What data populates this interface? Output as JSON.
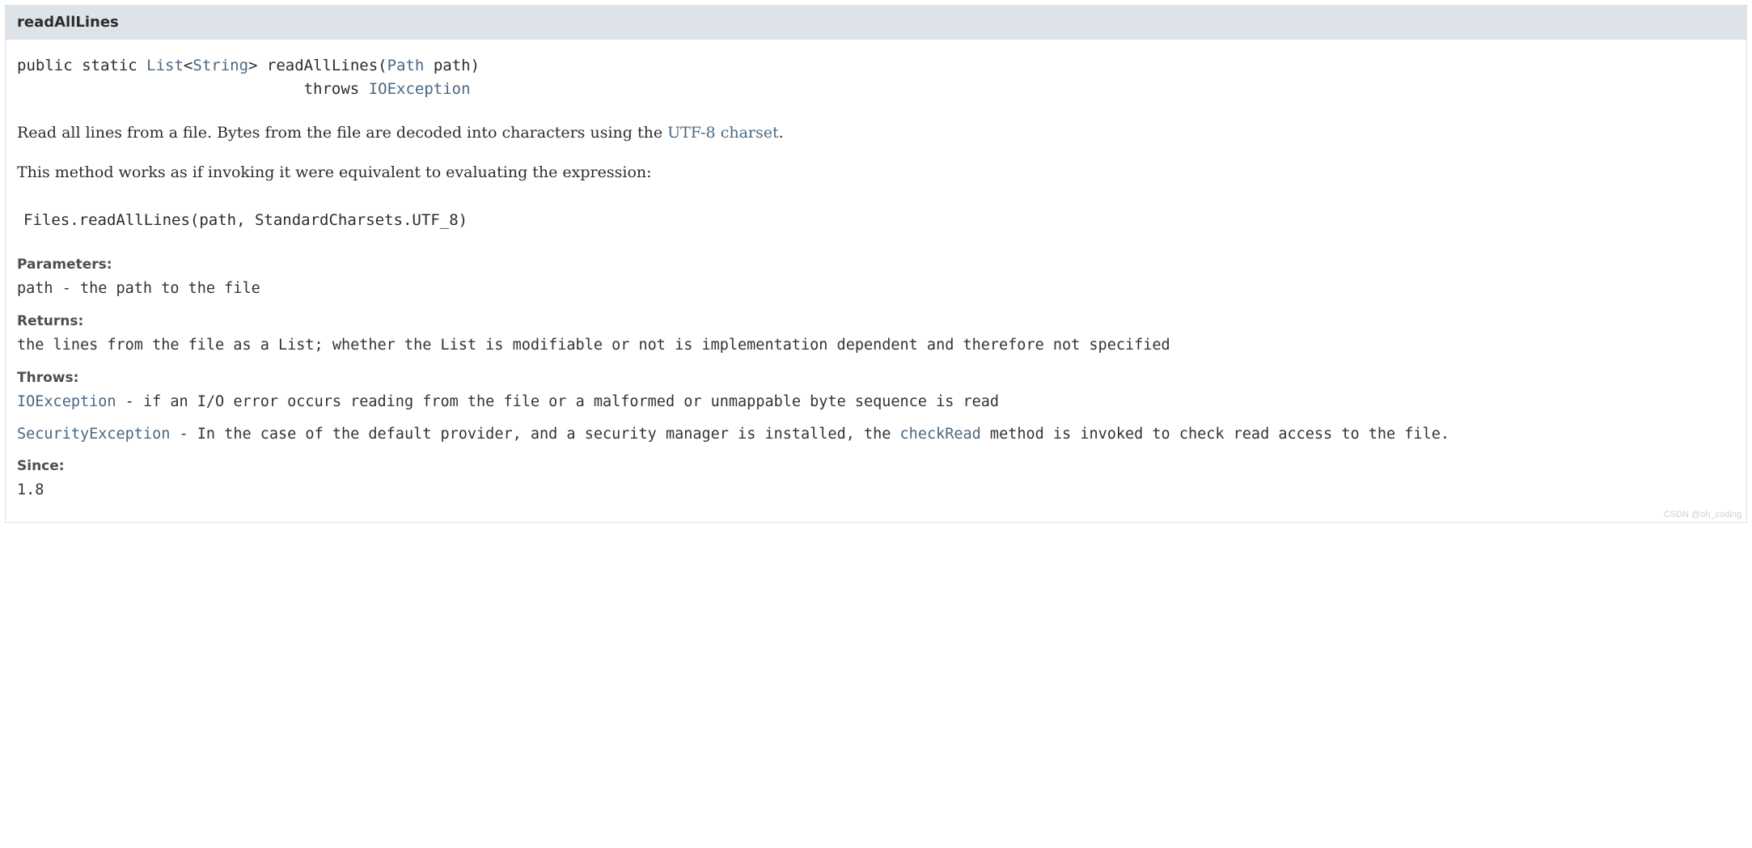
{
  "header": {
    "method_name": "readAllLines"
  },
  "signature": {
    "line1_prefix": "public static ",
    "list_link": "List",
    "angle_open": "<",
    "string_link": "String",
    "angle_close": "> readAllLines(",
    "path_link": "Path",
    "line1_suffix": " path)",
    "line2_indent": "                               throws ",
    "ioexception_link": "IOException"
  },
  "desc": {
    "para1_a": "Read all lines from a file. Bytes from the file are decoded into characters using the ",
    "utf8_link": "UTF-8 charset",
    "para1_b": ".",
    "para2": "This method works as if invoking it were equivalent to evaluating the expression:"
  },
  "code_block": "Files.readAllLines(path, StandardCharsets.UTF_8)",
  "sections": {
    "parameters_label": "Parameters:",
    "parameters_text": "path - the path to the file",
    "returns_label": "Returns:",
    "returns_text": "the lines from the file as a List; whether the List is modifiable or not is implementation dependent and therefore not specified",
    "throws_label": "Throws:",
    "throws1_link": "IOException",
    "throws1_text": " - if an I/O error occurs reading from the file or a malformed or unmappable byte sequence is read",
    "throws2_link": "SecurityException",
    "throws2_text_a": " - In the case of the default provider, and a security manager is installed, the ",
    "throws2_checkread": "checkRead",
    "throws2_text_b": " method is invoked to check read access to the file.",
    "since_label": "Since:",
    "since_text": "1.8"
  },
  "watermark": "CSDN @oh_coding"
}
